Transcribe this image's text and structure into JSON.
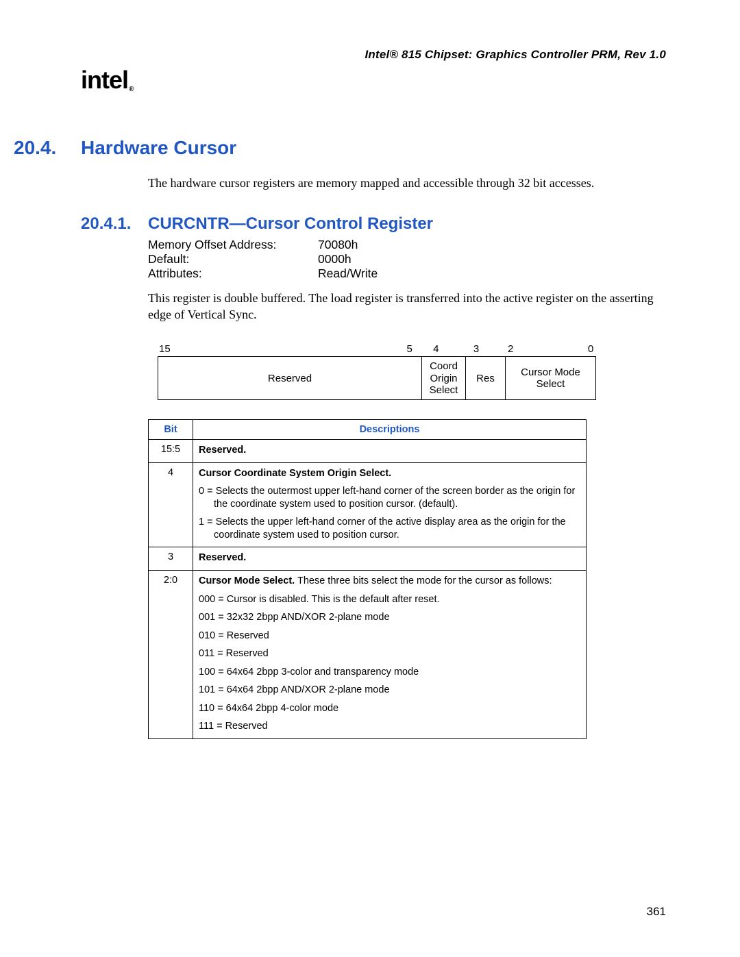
{
  "header": "Intel® 815 Chipset: Graphics Controller PRM, Rev 1.0",
  "logo_text": "intel",
  "section": {
    "num": "20.4.",
    "title": "Hardware Cursor"
  },
  "section_body": "The hardware cursor registers are memory mapped and accessible through 32 bit accesses.",
  "subsection": {
    "num": "20.4.1.",
    "title": "CURCNTR—Cursor Control Register"
  },
  "kv": [
    {
      "k": "Memory Offset Address:",
      "v": "70080h"
    },
    {
      "k": "Default:",
      "v": "0000h"
    },
    {
      "k": "Attributes:",
      "v": "Read/Write"
    }
  ],
  "reg_body": "This register is double buffered. The load register is transferred into the active register on the asserting edge of Vertical Sync.",
  "bit_labels": {
    "hi": "15",
    "lo": "5",
    "b4": "4",
    "b3": "3",
    "b2": "2",
    "b0": "0"
  },
  "bit_boxes": {
    "reserved": "Reserved",
    "coord": "Coord\nOrigin\nSelect",
    "res": "Res",
    "mode": "Cursor Mode\nSelect"
  },
  "table": {
    "h_bit": "Bit",
    "h_desc": "Descriptions",
    "rows": [
      {
        "bit": "15:5",
        "desc_bold": "Reserved."
      },
      {
        "bit": "4",
        "desc_bold": "Cursor Coordinate System Origin Select.",
        "paras": [
          "0 = Selects the outermost upper left-hand corner of the screen border as the origin for the coordinate system used to position cursor. (default).",
          "1 = Selects the upper left-hand corner of the active display area as the origin for the coordinate system used to position cursor."
        ]
      },
      {
        "bit": "3",
        "desc_bold": "Reserved."
      },
      {
        "bit": "2:0",
        "desc_bold": "Cursor Mode Select.",
        "desc_tail": " These three bits select the mode for the cursor as follows:",
        "paras": [
          "000 = Cursor is disabled. This is the default after reset.",
          "001 = 32x32 2bpp AND/XOR 2-plane mode",
          "010 = Reserved",
          "011 = Reserved",
          "100 = 64x64 2bpp 3-color and transparency mode",
          "101 = 64x64 2bpp AND/XOR 2-plane mode",
          "110 = 64x64 2bpp 4-color mode",
          "111 = Reserved"
        ]
      }
    ]
  },
  "page_number": "361"
}
